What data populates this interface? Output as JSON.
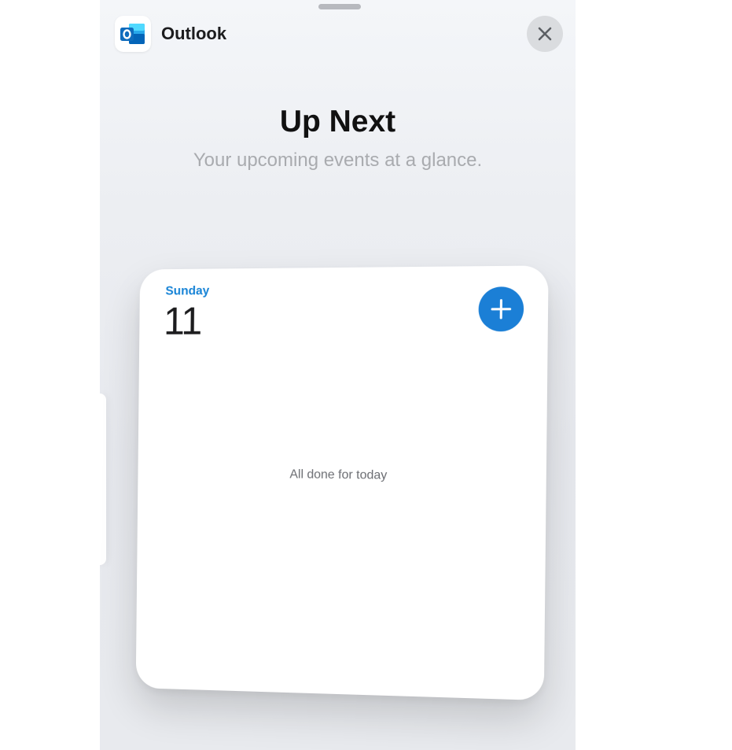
{
  "app": {
    "name": "Outlook",
    "icon": "outlook-icon",
    "brand_color": "#0f6cbd"
  },
  "header": {
    "close_icon": "close-icon"
  },
  "widget_gallery": {
    "title": "Up Next",
    "subtitle": "Your upcoming events at a glance."
  },
  "widget": {
    "day_name": "Sunday",
    "day_number": "11",
    "add_icon": "plus-icon",
    "empty_message": "All done for today",
    "accent_color": "#1b7fd6"
  }
}
